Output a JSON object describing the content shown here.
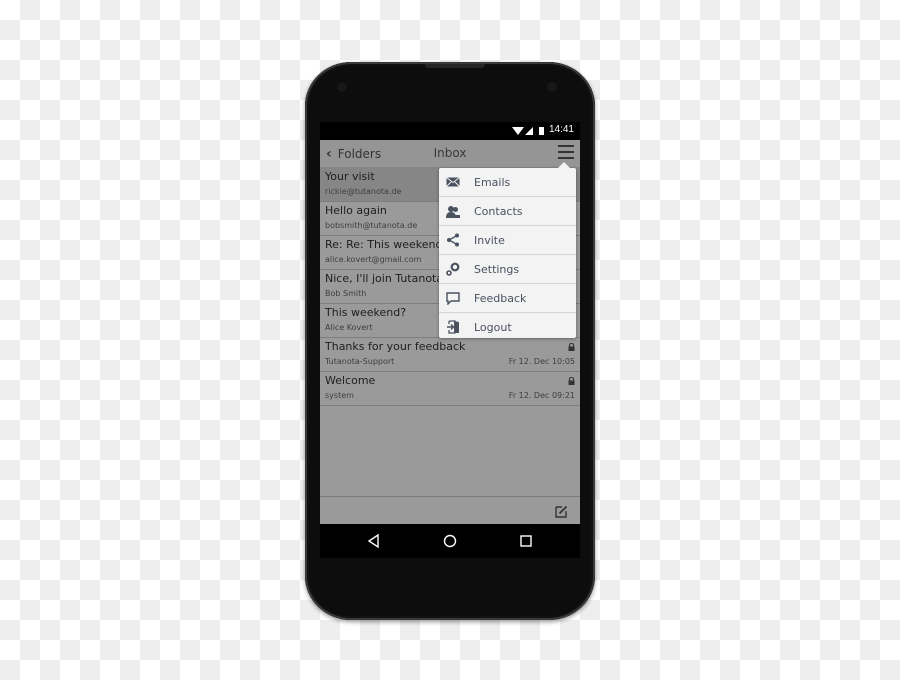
{
  "status_bar": {
    "time": "14:41",
    "icons": [
      "wifi-icon",
      "signal-icon",
      "battery-icon"
    ]
  },
  "header": {
    "back_label": "Folders",
    "title": "Inbox",
    "menu_icon": "hamburger-menu-icon"
  },
  "emails": [
    {
      "subject": "Your visit",
      "sender": "rickie@tutanota.de",
      "date": "",
      "locked": false,
      "selected": true
    },
    {
      "subject": "Hello again",
      "sender": "bobsmith@tutanota.de",
      "date": "",
      "locked": false,
      "selected": false
    },
    {
      "subject": "Re: Re: This weekend?",
      "sender": "alice.kovert@gmail.com",
      "date": "",
      "locked": false,
      "selected": false
    },
    {
      "subject": "Nice, I'll join Tutanota",
      "sender": "Bob Smith",
      "date": "",
      "locked": false,
      "selected": false
    },
    {
      "subject": "This weekend?",
      "sender": "Alice Kovert",
      "date": "",
      "locked": false,
      "selected": false
    },
    {
      "subject": "Thanks for your feedback",
      "sender": "Tutanota-Support",
      "date": "Fr 12. Dec 10:05",
      "locked": true,
      "selected": false
    },
    {
      "subject": "Welcome",
      "sender": "system",
      "date": "Fr 12. Dec 09:21",
      "locked": true,
      "selected": false
    }
  ],
  "menu": {
    "items": [
      {
        "label": "Emails",
        "icon": "envelope-icon"
      },
      {
        "label": "Contacts",
        "icon": "contacts-icon"
      },
      {
        "label": "Invite",
        "icon": "share-icon"
      },
      {
        "label": "Settings",
        "icon": "settings-icon"
      },
      {
        "label": "Feedback",
        "icon": "feedback-icon"
      },
      {
        "label": "Logout",
        "icon": "logout-icon"
      }
    ]
  },
  "bottom_bar": {
    "compose_icon": "compose-icon"
  },
  "nav_bar": {
    "icons": [
      "back-nav-icon",
      "home-nav-icon",
      "recents-nav-icon"
    ]
  },
  "colors": {
    "menu_text": "#4a5260",
    "list_bg": "#9a9a9a",
    "selected_row": "#868686"
  }
}
